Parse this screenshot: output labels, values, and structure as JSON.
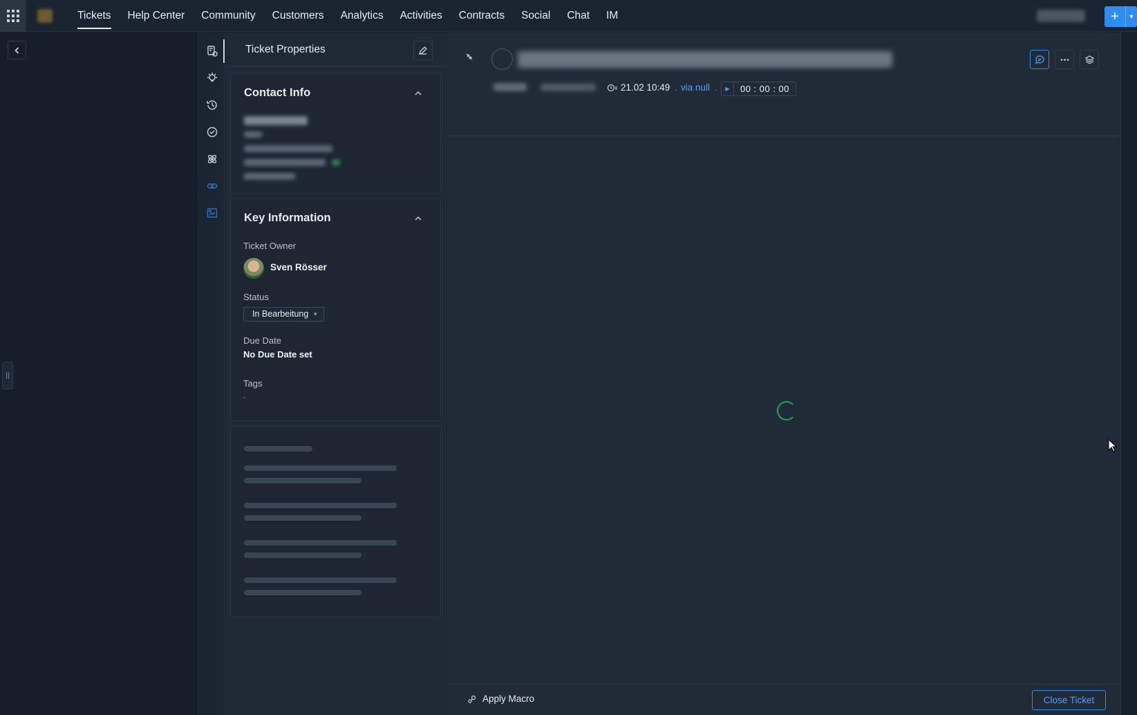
{
  "nav": {
    "items": [
      "Tickets",
      "Help Center",
      "Community",
      "Customers",
      "Analytics",
      "Activities",
      "Contracts",
      "Social",
      "Chat",
      "IM"
    ],
    "active": "Tickets",
    "new_button": "+"
  },
  "properties": {
    "title": "Ticket Properties",
    "contact_info": {
      "title": "Contact Info"
    },
    "key_information": {
      "title": "Key Information",
      "owner_label": "Ticket Owner",
      "owner_name": "Sven Rösser",
      "status_label": "Status",
      "status_value": "In Bearbeitung",
      "due_label": "Due Date",
      "due_value": "No Due Date set",
      "tags_label": "Tags",
      "tags_value": "-"
    }
  },
  "ticket": {
    "time": "21.02 10:49",
    "via": "via null",
    "timer": "00 : 00 : 00"
  },
  "footer": {
    "apply_macro": "Apply Macro",
    "close_ticket": "Close Ticket"
  },
  "colors": {
    "accent": "#2f8cf0",
    "link": "#4ea0ff",
    "spinner": "#1fa35a",
    "background": "#212b37"
  }
}
